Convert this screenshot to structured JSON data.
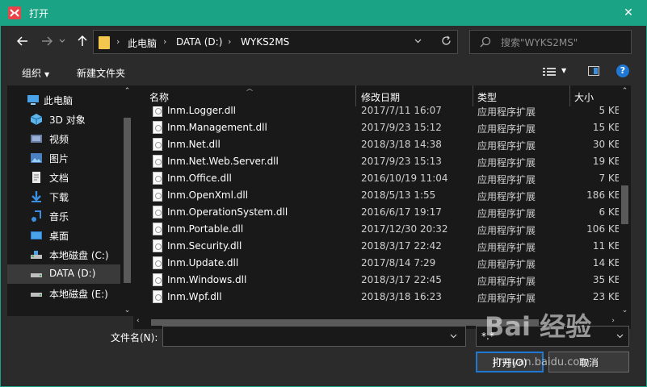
{
  "window": {
    "title": "打开",
    "close_glyph": "✕",
    "app_icon": "xmind-logo-icon"
  },
  "nav": {
    "address_crumbs": [
      "此电脑",
      "DATA (D:)",
      "WYKS2MS"
    ],
    "crumb_separator": "›",
    "search_placeholder": "搜索\"WYKS2MS\""
  },
  "toolbar": {
    "organize_label": "组织",
    "new_folder_label": "新建文件夹",
    "help_label": "?"
  },
  "sidebar": {
    "items": [
      {
        "label": "此电脑",
        "icon": "computer-icon",
        "indent": 0
      },
      {
        "label": "3D 对象",
        "icon": "3d-objects-icon",
        "indent": 1
      },
      {
        "label": "视频",
        "icon": "video-icon",
        "indent": 1
      },
      {
        "label": "图片",
        "icon": "pictures-icon",
        "indent": 1
      },
      {
        "label": "文档",
        "icon": "documents-icon",
        "indent": 1
      },
      {
        "label": "下载",
        "icon": "downloads-icon",
        "indent": 1
      },
      {
        "label": "音乐",
        "icon": "music-icon",
        "indent": 1
      },
      {
        "label": "桌面",
        "icon": "desktop-icon",
        "indent": 1
      },
      {
        "label": "本地磁盘 (C:)",
        "icon": "drive-c-icon",
        "indent": 1
      },
      {
        "label": "DATA (D:)",
        "icon": "drive-d-icon",
        "indent": 1,
        "selected": true
      },
      {
        "label": "本地磁盘 (E:)",
        "icon": "drive-e-icon",
        "indent": 1
      }
    ]
  },
  "columns": {
    "name": "名称",
    "date": "修改日期",
    "type": "类型",
    "size": "大小"
  },
  "files": [
    {
      "name": "Inm.Logger.dll",
      "date": "2017/7/11 16:07",
      "type": "应用程序扩展",
      "size": "5 KB"
    },
    {
      "name": "Inm.Management.dll",
      "date": "2017/9/23 15:12",
      "type": "应用程序扩展",
      "size": "15 KB"
    },
    {
      "name": "Inm.Net.dll",
      "date": "2018/3/18 14:38",
      "type": "应用程序扩展",
      "size": "30 KB"
    },
    {
      "name": "Inm.Net.Web.Server.dll",
      "date": "2017/9/23 15:13",
      "type": "应用程序扩展",
      "size": "19 KB"
    },
    {
      "name": "Inm.Office.dll",
      "date": "2016/10/19 11:04",
      "type": "应用程序扩展",
      "size": "7 KB"
    },
    {
      "name": "Inm.OpenXml.dll",
      "date": "2018/5/13 1:55",
      "type": "应用程序扩展",
      "size": "186 KB"
    },
    {
      "name": "Inm.OperationSystem.dll",
      "date": "2016/6/17 19:17",
      "type": "应用程序扩展",
      "size": "6 KB"
    },
    {
      "name": "Inm.Portable.dll",
      "date": "2017/12/30 20:32",
      "type": "应用程序扩展",
      "size": "106 KB"
    },
    {
      "name": "Inm.Security.dll",
      "date": "2018/3/17 22:42",
      "type": "应用程序扩展",
      "size": "11 KB"
    },
    {
      "name": "Inm.Update.dll",
      "date": "2017/8/14 7:29",
      "type": "应用程序扩展",
      "size": "14 KB"
    },
    {
      "name": "Inm.Windows.dll",
      "date": "2018/3/17 22:45",
      "type": "应用程序扩展",
      "size": "35 KB"
    },
    {
      "name": "Inm.Wpf.dll",
      "date": "2018/3/18 16:23",
      "type": "应用程序扩展",
      "size": "23 KB"
    }
  ],
  "footer": {
    "filename_label": "文件名(N):",
    "filename_value": "",
    "filter_value": "*.*",
    "open_label": "打开(O)",
    "cancel_label": "取消"
  },
  "watermark": {
    "main": "Bai 经验",
    "sub": "jingyan.baidu.com"
  },
  "colors": {
    "accent": "#1ba385",
    "background": "#2b2b2b",
    "pane": "#191919",
    "selection": "#3a3a3a",
    "focus_blue": "#1e78d4",
    "folder_yellow": "#f3c64e"
  }
}
